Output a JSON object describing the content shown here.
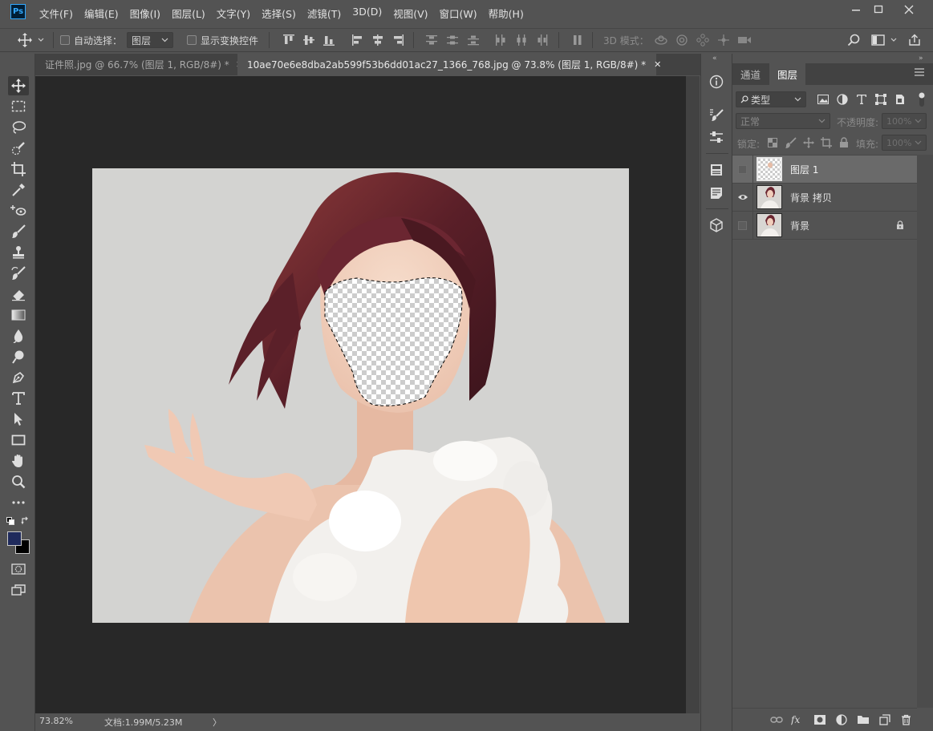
{
  "app": {
    "logo": "Ps"
  },
  "menu": [
    "文件(F)",
    "编辑(E)",
    "图像(I)",
    "图层(L)",
    "文字(Y)",
    "选择(S)",
    "滤镜(T)",
    "3D(D)",
    "视图(V)",
    "窗口(W)",
    "帮助(H)"
  ],
  "options": {
    "auto_select_label": "自动选择：",
    "auto_select_target": "图层",
    "show_transform_label": "显示变换控件",
    "mode_3d_label": "3D 模式："
  },
  "tabs": [
    {
      "title": "证件照.jpg @ 66.7% (图层 1, RGB/8#) *",
      "active": false
    },
    {
      "title": "10ae70e6e8dba2ab599f53b6dd01ac27_1366_768.jpg @ 73.8% (图层 1, RGB/8#) *",
      "active": true
    }
  ],
  "status": {
    "zoom": "73.82%",
    "doc_info": "文档:1.99M/5.23M",
    "arrow": "〉"
  },
  "panel": {
    "tabs": [
      "通道",
      "图层"
    ],
    "active_tab": "图层",
    "filter_label": "类型",
    "blend_mode": "正常",
    "opacity_label": "不透明度:",
    "opacity_value": "100%",
    "lock_label": "锁定:",
    "fill_label": "填充:",
    "fill_value": "100%",
    "layers": [
      {
        "name": "图层 1",
        "visible": false,
        "selected": true,
        "locked": false
      },
      {
        "name": "背景 拷贝",
        "visible": true,
        "selected": false,
        "locked": false
      },
      {
        "name": "背景",
        "visible": false,
        "selected": false,
        "locked": true
      }
    ]
  },
  "colors": {
    "foreground": "#1f2a5c",
    "background": "#000000",
    "ui_bg": "#535353",
    "canvas_bg": "#282828"
  },
  "icons": [
    "move-icon",
    "marquee-icon",
    "lasso-icon",
    "quick-select-icon",
    "crop-icon",
    "eyedropper-icon",
    "healing-brush-icon",
    "brush-icon",
    "clone-stamp-icon",
    "history-brush-icon",
    "eraser-icon",
    "gradient-icon",
    "blur-icon",
    "dodge-icon",
    "pen-icon",
    "type-icon",
    "path-select-icon",
    "rectangle-icon",
    "hand-icon",
    "zoom-icon",
    "more-tools-icon"
  ]
}
